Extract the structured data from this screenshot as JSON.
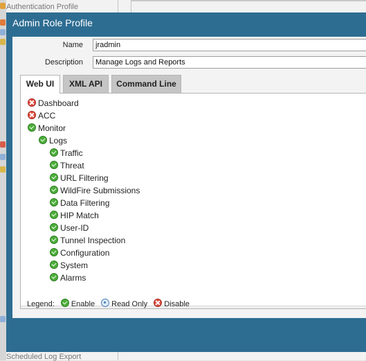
{
  "background": {
    "top_item": "Authentication Profile",
    "bottom_item": "Scheduled Log Export"
  },
  "dialog": {
    "title": "Admin Role Profile",
    "name_label": "Name",
    "name_value": "jradmin",
    "description_label": "Description",
    "description_value": "Manage Logs and Reports"
  },
  "tabs": [
    {
      "label": "Web UI",
      "active": true
    },
    {
      "label": "XML API",
      "active": false
    },
    {
      "label": "Command Line",
      "active": false
    }
  ],
  "tree": [
    {
      "label": "Dashboard",
      "state": "disable",
      "level": 0
    },
    {
      "label": "ACC",
      "state": "disable",
      "level": 0
    },
    {
      "label": "Monitor",
      "state": "enable",
      "level": 0
    },
    {
      "label": "Logs",
      "state": "enable",
      "level": 1
    },
    {
      "label": "Traffic",
      "state": "enable",
      "level": 2
    },
    {
      "label": "Threat",
      "state": "enable",
      "level": 2
    },
    {
      "label": "URL Filtering",
      "state": "enable",
      "level": 2
    },
    {
      "label": "WildFire Submissions",
      "state": "enable",
      "level": 2
    },
    {
      "label": "Data Filtering",
      "state": "enable",
      "level": 2
    },
    {
      "label": "HIP Match",
      "state": "enable",
      "level": 2
    },
    {
      "label": "User-ID",
      "state": "enable",
      "level": 2
    },
    {
      "label": "Tunnel Inspection",
      "state": "enable",
      "level": 2
    },
    {
      "label": "Configuration",
      "state": "enable",
      "level": 2
    },
    {
      "label": "System",
      "state": "enable",
      "level": 2
    },
    {
      "label": "Alarms",
      "state": "enable",
      "level": 2
    }
  ],
  "legend": {
    "label": "Legend:",
    "enable": "Enable",
    "read_only": "Read Only",
    "disable": "Disable"
  },
  "colors": {
    "dialog_frame": "#2e6d92",
    "enable": "#4cae3a",
    "disable": "#e04b3d"
  }
}
